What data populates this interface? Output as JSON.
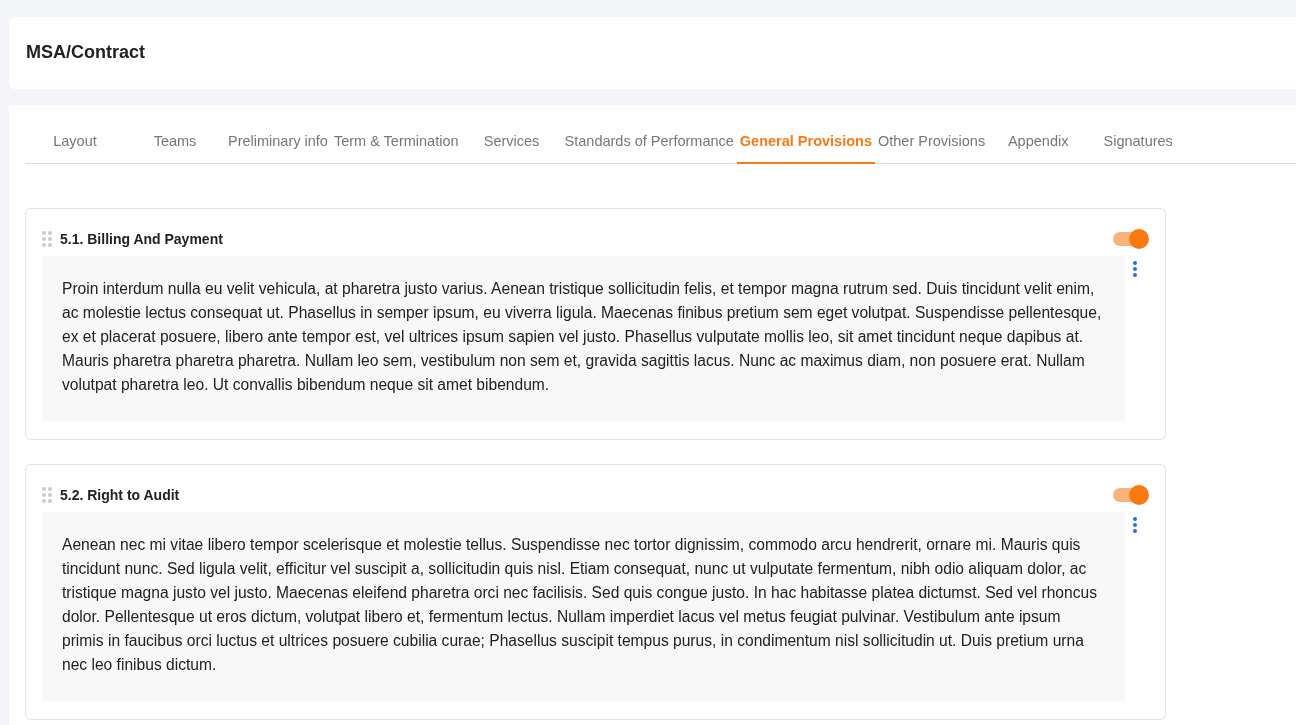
{
  "header": {
    "title": "MSA/Contract"
  },
  "tabs": [
    {
      "label": "Layout",
      "selected": false
    },
    {
      "label": "Teams",
      "selected": false
    },
    {
      "label": "Preliminary info",
      "selected": false
    },
    {
      "label": "Term & Termination",
      "selected": false
    },
    {
      "label": "Services",
      "selected": false
    },
    {
      "label": "Standards of Performance",
      "selected": false
    },
    {
      "label": "General Provisions",
      "selected": true
    },
    {
      "label": "Other Provisions",
      "selected": false
    },
    {
      "label": "Appendix",
      "selected": false
    },
    {
      "label": "Signatures",
      "selected": false
    }
  ],
  "sections": [
    {
      "title": "5.1. Billing And Payment",
      "on": true,
      "body": "Proin interdum nulla eu velit vehicula, at pharetra justo varius. Aenean tristique sollicitudin felis, et tempor magna rutrum sed. Duis tincidunt velit enim, ac molestie lectus consequat ut. Phasellus in semper ipsum, eu viverra ligula. Maecenas finibus pretium sem eget volutpat. Suspendisse pellentesque, ex et placerat posuere, libero ante tempor est, vel ultrices ipsum sapien vel justo. Phasellus vulputate mollis leo, sit amet tincidunt neque dapibus at. Mauris pharetra pharetra pharetra. Nullam leo sem, vestibulum non sem et, gravida sagittis lacus. Nunc ac maximus diam, non posuere erat. Nullam volutpat pharetra leo. Ut convallis bibendum neque sit amet bibendum."
    },
    {
      "title": "5.2. Right to Audit",
      "on": true,
      "body": "Aenean nec mi vitae libero tempor scelerisque et molestie tellus. Suspendisse nec tortor dignissim, commodo arcu hendrerit, ornare mi. Mauris quis tincidunt nunc. Sed ligula velit, efficitur vel suscipit a, sollicitudin quis nisl. Etiam consequat, nunc ut vulputate fermentum, nibh odio aliquam dolor, ac tristique magna justo vel justo. Maecenas eleifend pharetra orci nec facilisis. Sed quis congue justo. In hac habitasse platea dictumst. Sed vel rhoncus dolor. Pellentesque ut eros dictum, volutpat libero et, fermentum lectus. Nullam imperdiet lacus vel metus feugiat pulvinar. Vestibulum ante ipsum primis in faucibus orci luctus et ultrices posuere cubilia curae; Phasellus suscipit tempus purus, in condimentum nisl sollicitudin ut. Duis pretium urna nec leo finibus dictum."
    }
  ]
}
